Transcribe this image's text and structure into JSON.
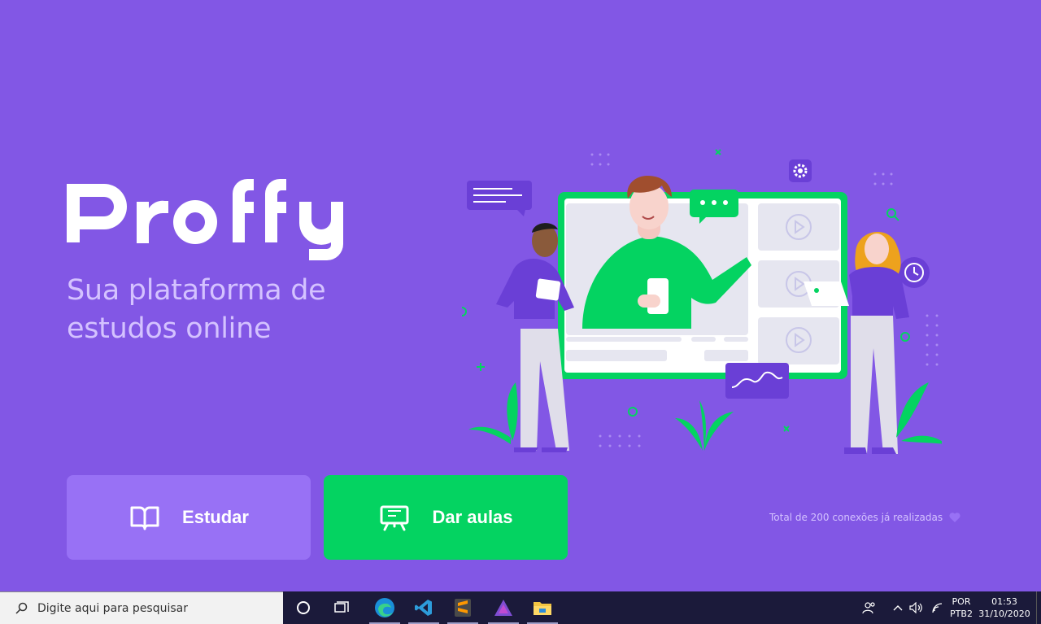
{
  "app": {
    "logo_text": "Proffy",
    "tagline_line1": "Sua plataforma de",
    "tagline_line2": "estudos online",
    "buttons": {
      "study_label": "Estudar",
      "give_classes_label": "Dar aulas"
    },
    "connections_text": "Total de 200 conexões já realizadas",
    "colors": {
      "background": "#8257E5",
      "primary_light": "#9871F5",
      "secondary": "#04D361",
      "tagline": "#D4C2FF"
    }
  },
  "taskbar": {
    "search_placeholder": "Digite aqui para pesquisar",
    "apps": [
      "cortana-icon",
      "task-view-icon",
      "edge-icon",
      "vscode-icon",
      "sublime-icon",
      "affinity-icon",
      "file-explorer-icon"
    ],
    "language_line1": "POR",
    "language_line2": "PTB2",
    "time": "01:53",
    "date": "31/10/2020"
  }
}
